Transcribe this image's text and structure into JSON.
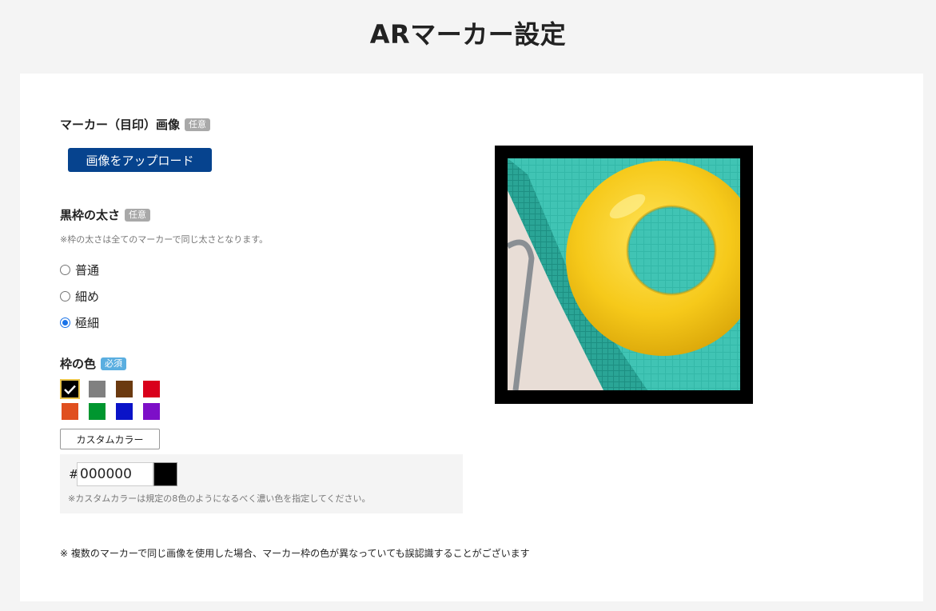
{
  "header": {
    "title": "ARマーカー設定"
  },
  "marker_image": {
    "label": "マーカー（目印）画像",
    "badge": "任意",
    "upload_label": "画像をアップロード"
  },
  "frame_width": {
    "label": "黒枠の太さ",
    "badge": "任意",
    "note": "※枠の太さは全てのマーカーで同じ太さとなります。",
    "options": [
      {
        "label": "普通",
        "checked": false
      },
      {
        "label": "細め",
        "checked": false
      },
      {
        "label": "極細",
        "checked": true
      }
    ]
  },
  "frame_color": {
    "label": "枠の色",
    "badge": "必須",
    "swatches": [
      "#000000",
      "#808080",
      "#6b3a10",
      "#d9001b",
      "#e04f1f",
      "#00962f",
      "#0a13c8",
      "#7d0fc8"
    ],
    "selected_index": 0,
    "custom_button_label": "カスタムカラー",
    "hash_symbol": "#",
    "hex_value": "000000",
    "custom_note": "※カスタムカラーは規定の8色のようになるべく濃い色を指定してください。"
  },
  "footer_note": "※ 複数のマーカーで同じ画像を使用した場合、マーカー枠の色が異なっていても誤認識することがございます"
}
